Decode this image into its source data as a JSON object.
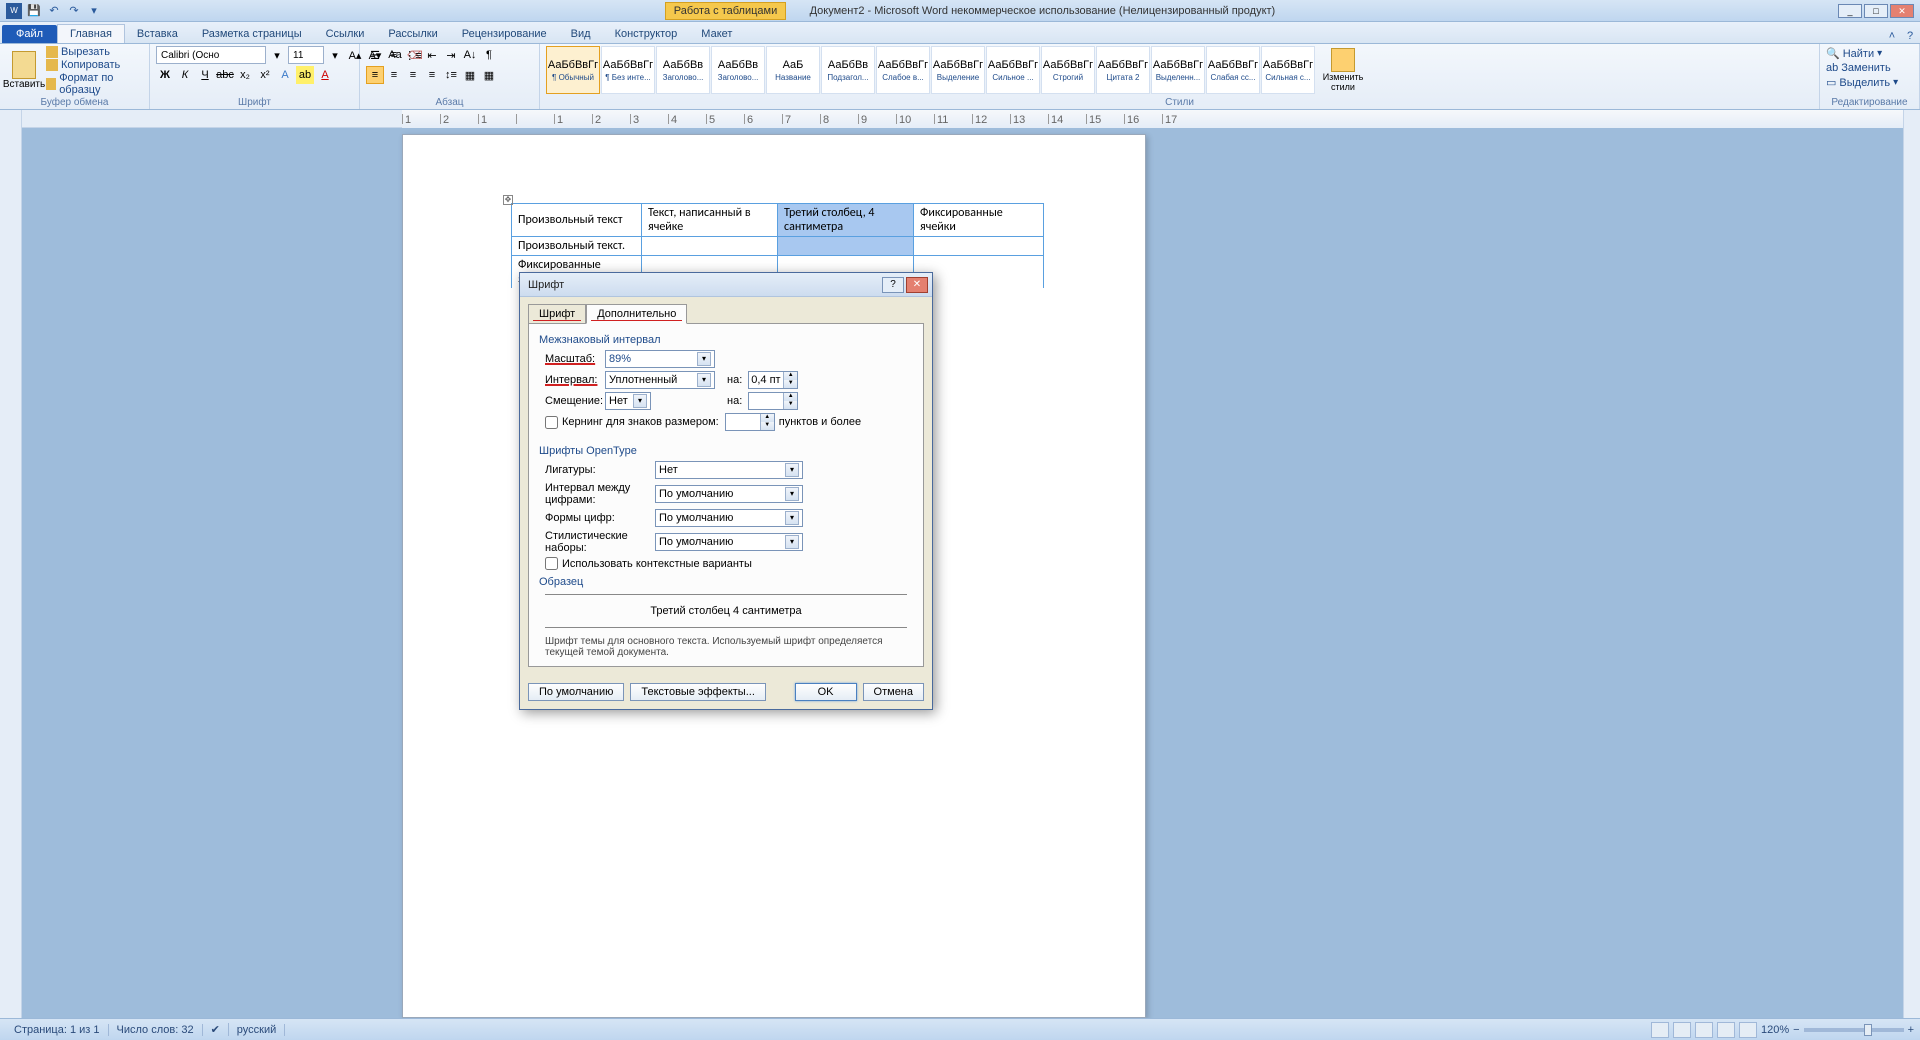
{
  "title": "Документ2 - Microsoft Word некоммерческое использование (Нелицензированный продукт)",
  "table_tools": "Работа с таблицами",
  "tabs": {
    "file": "Файл",
    "home": "Главная",
    "insert": "Вставка",
    "layout": "Разметка страницы",
    "references": "Ссылки",
    "mailings": "Рассылки",
    "review": "Рецензирование",
    "view": "Вид",
    "design": "Конструктор",
    "tbl_layout": "Макет"
  },
  "ribbon": {
    "clipboard": {
      "label": "Буфер обмена",
      "paste": "Вставить",
      "cut": "Вырезать",
      "copy": "Копировать",
      "format_painter": "Формат по образцу"
    },
    "font": {
      "label": "Шрифт",
      "name": "Calibri (Осно",
      "size": "11"
    },
    "paragraph": {
      "label": "Абзац"
    },
    "styles": {
      "label": "Стили",
      "change": "Изменить стили",
      "items": [
        {
          "sample": "АаБбВвГг",
          "name": "¶ Обычный"
        },
        {
          "sample": "АаБбВвГг",
          "name": "¶ Без инте..."
        },
        {
          "sample": "АаБбВв",
          "name": "Заголово..."
        },
        {
          "sample": "АаБбВв",
          "name": "Заголово..."
        },
        {
          "sample": "АаБ",
          "name": "Название"
        },
        {
          "sample": "АаБбВв",
          "name": "Подзагол..."
        },
        {
          "sample": "АаБбВвГг",
          "name": "Слабое в..."
        },
        {
          "sample": "АаБбВвГг",
          "name": "Выделение"
        },
        {
          "sample": "АаБбВвГг",
          "name": "Сильное ..."
        },
        {
          "sample": "АаБбВвГг",
          "name": "Строгий"
        },
        {
          "sample": "АаБбВвГг",
          "name": "Цитата 2"
        },
        {
          "sample": "АаБбВвГг",
          "name": "Выделенн..."
        },
        {
          "sample": "АаБбВвГг",
          "name": "Слабая сс..."
        },
        {
          "sample": "АаБбВвГг",
          "name": "Сильная с..."
        }
      ]
    },
    "editing": {
      "label": "Редактирование",
      "find": "Найти",
      "replace": "Заменить",
      "select": "Выделить"
    }
  },
  "doc_table": {
    "r1c1": "Произвольный текст",
    "r1c2": "Текст,  написанный  в ячейке",
    "r1c3": "Третий  столбец, 4 сантиметра",
    "r1c4": "Фиксированные ячейки",
    "r2c1": "Произвольный текст.",
    "r3c1_partial": "Фиксированные ячейки"
  },
  "dialog": {
    "title": "Шрифт",
    "tab_font": "Шрифт",
    "tab_adv": "Дополнительно",
    "section_spacing": "Межзнаковый интервал",
    "scale_label": "Масштаб:",
    "scale_value": "89%",
    "spacing_label": "Интервал:",
    "spacing_value": "Уплотненный",
    "by_label": "на:",
    "by_value": "0,4 пт",
    "position_label": "Смещение:",
    "position_value": "Нет",
    "pos_by_label": "на:",
    "kerning_label": "Кернинг для знаков размером:",
    "kerning_suffix": "пунктов и более",
    "section_opentype": "Шрифты OpenType",
    "ligatures_label": "Лигатуры:",
    "ligatures_value": "Нет",
    "num_spacing_label": "Интервал между цифрами:",
    "num_spacing_value": "По умолчанию",
    "num_forms_label": "Формы цифр:",
    "num_forms_value": "По умолчанию",
    "style_sets_label": "Стилистические наборы:",
    "style_sets_value": "По умолчанию",
    "contextual": "Использовать контекстные варианты",
    "preview_label": "Образец",
    "preview_text": "Третий столбец 4 сантиметра",
    "note": "Шрифт темы для основного текста. Используемый шрифт определяется текущей темой документа.",
    "btn_default": "По умолчанию",
    "btn_text_effects": "Текстовые эффекты...",
    "btn_ok": "OK",
    "btn_cancel": "Отмена"
  },
  "status": {
    "page": "Страница: 1 из 1",
    "words": "Число слов: 32",
    "lang": "русский",
    "zoom": "120%"
  },
  "ruler_ticks": [
    "1",
    "2",
    "1",
    "",
    "1",
    "2",
    "3",
    "4",
    "5",
    "6",
    "7",
    "8",
    "9",
    "10",
    "11",
    "12",
    "13",
    "14",
    "15",
    "16",
    "17"
  ]
}
